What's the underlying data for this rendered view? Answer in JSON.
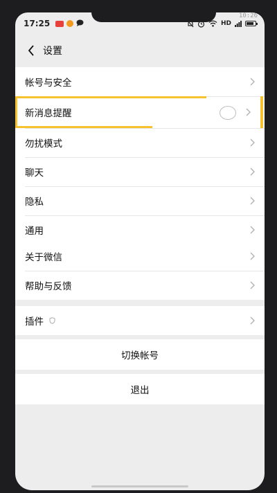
{
  "status_bar": {
    "time": "17:25",
    "network": "HD",
    "corner_clock": "10:26",
    "icons": [
      "red-app-icon",
      "orange-app-icon",
      "message-icon",
      "bell-off-icon",
      "alarm-icon",
      "wifi-icon",
      "battery-icon"
    ]
  },
  "nav": {
    "back_icon": "chevron-left-icon",
    "title": "设置"
  },
  "settings": {
    "group1": [
      {
        "label": "帐号与安全"
      },
      {
        "label": "新消息提醒",
        "highlighted": true
      },
      {
        "label": "勿扰模式"
      },
      {
        "label": "聊天"
      },
      {
        "label": "隐私"
      },
      {
        "label": "通用"
      }
    ],
    "group2": [
      {
        "label": "关于微信"
      },
      {
        "label": "帮助与反馈"
      }
    ],
    "group3": [
      {
        "label": "插件",
        "icon": "shield-icon"
      }
    ],
    "switch_account": "切换帐号",
    "logout": "退出"
  },
  "colors": {
    "highlight": "#f6c22e",
    "page_background": "#ededed",
    "row_background": "#ffffff"
  }
}
